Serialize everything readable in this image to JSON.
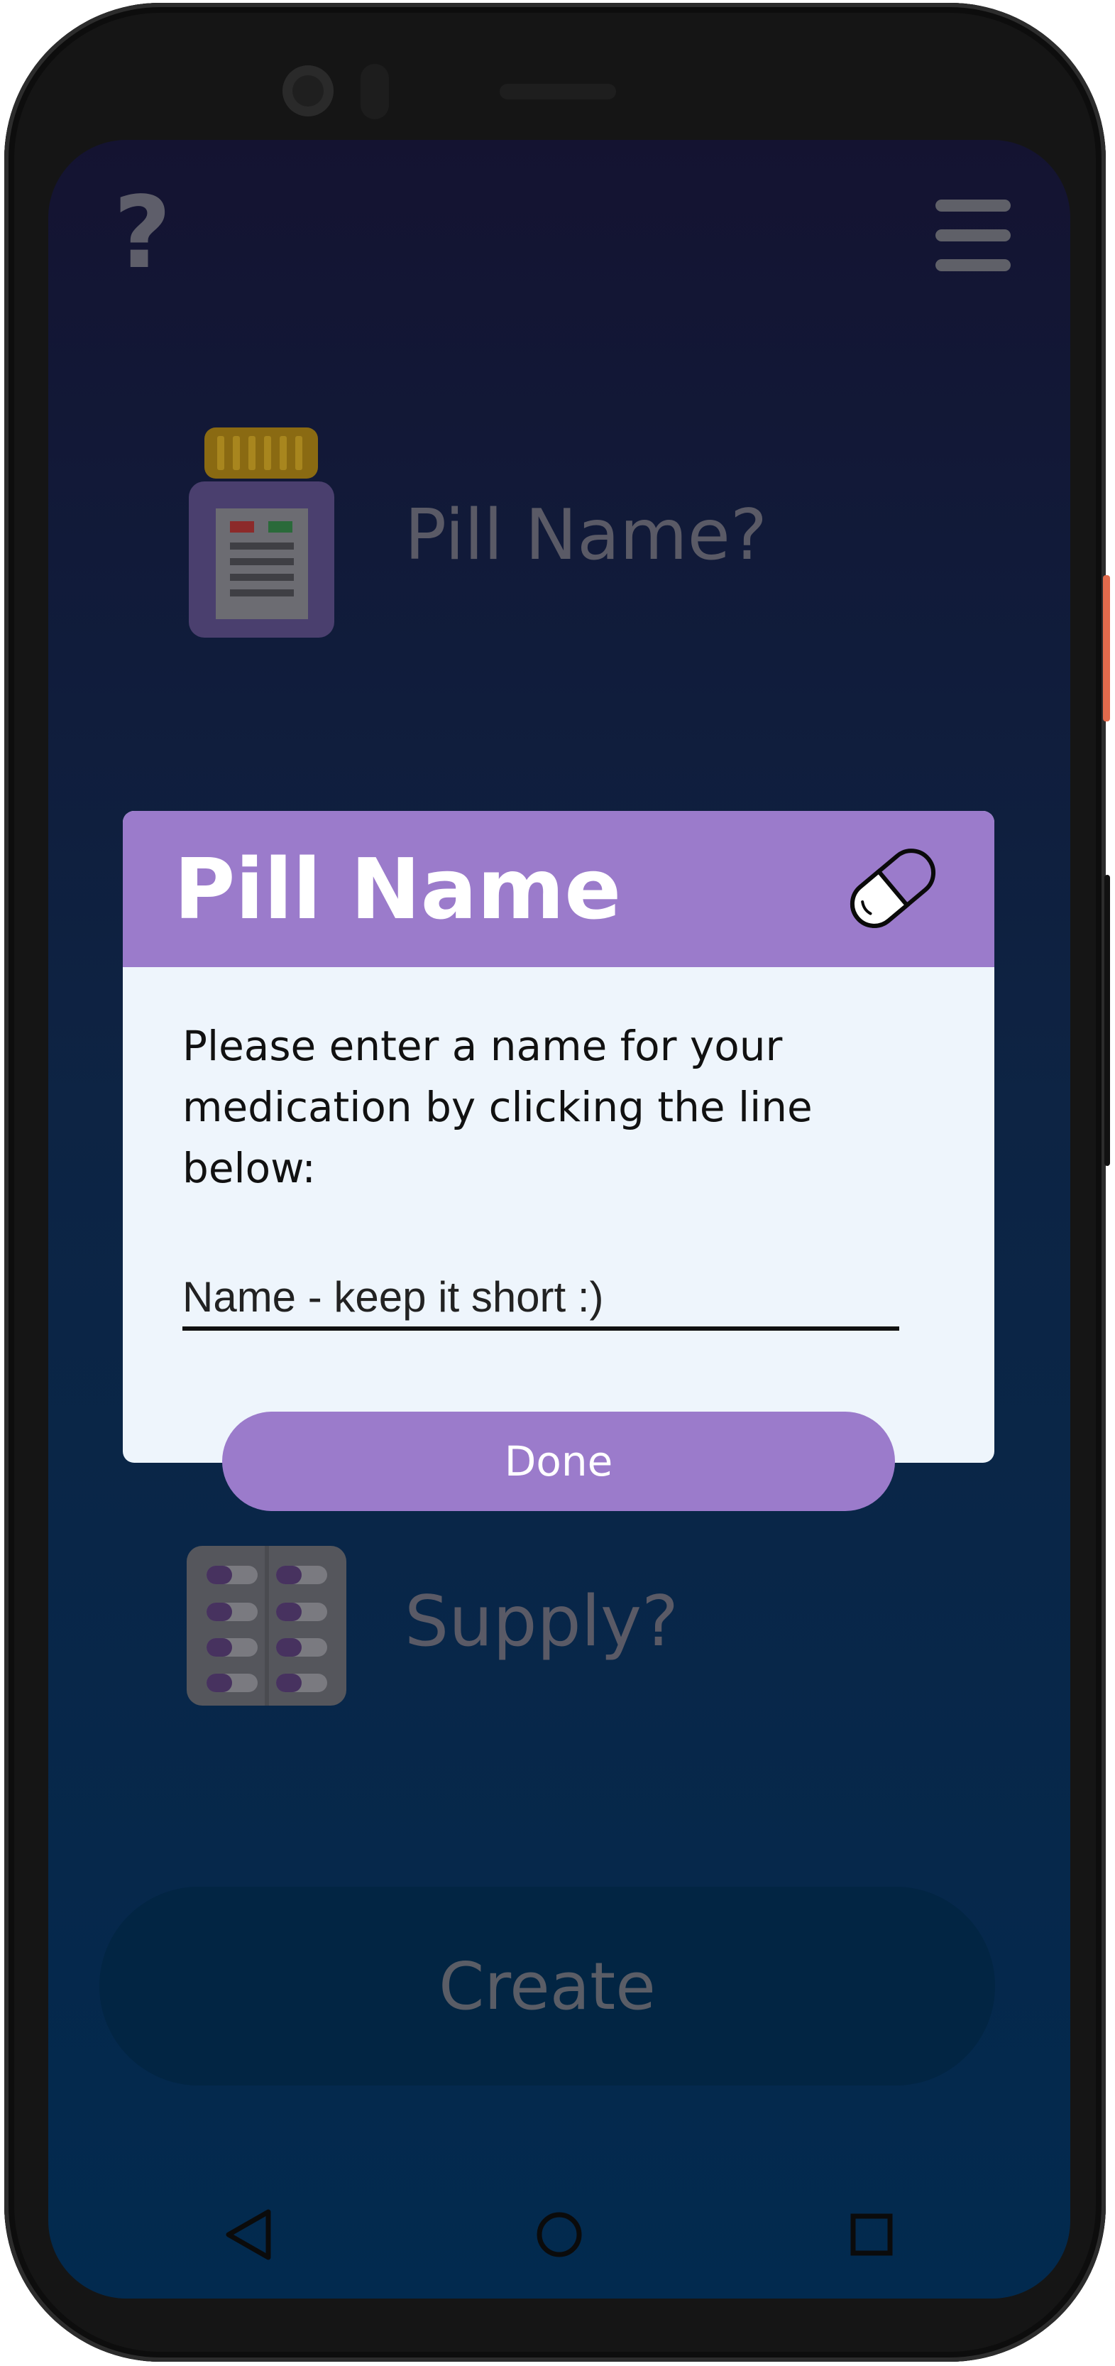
{
  "top_bar": {
    "help_icon": "question-mark-icon",
    "help_glyph": "?",
    "menu_icon": "hamburger-menu-icon"
  },
  "form": {
    "pill_name_label": "Pill Name?",
    "pill_name_icon": "pill-bottle-icon",
    "supply_label": "Supply?",
    "supply_icon": "blister-pack-icon",
    "create_label": "Create"
  },
  "dialog": {
    "title": "Pill Name",
    "title_icon": "capsule-icon",
    "message": "Please enter a name for your medication by clicking the line below:",
    "input_value": "",
    "input_placeholder": "Name - keep it short :)",
    "done_label": "Done"
  },
  "navbar": {
    "back_icon": "back-triangle-icon",
    "home_icon": "home-circle-icon",
    "recents_icon": "recents-square-icon"
  },
  "colors": {
    "accent": "#9b7bcb",
    "dialog_bg": "#eef5fc",
    "bg_top": "#141331",
    "bg_bottom": "#022a4f",
    "dim_text": "#5a5a66"
  }
}
